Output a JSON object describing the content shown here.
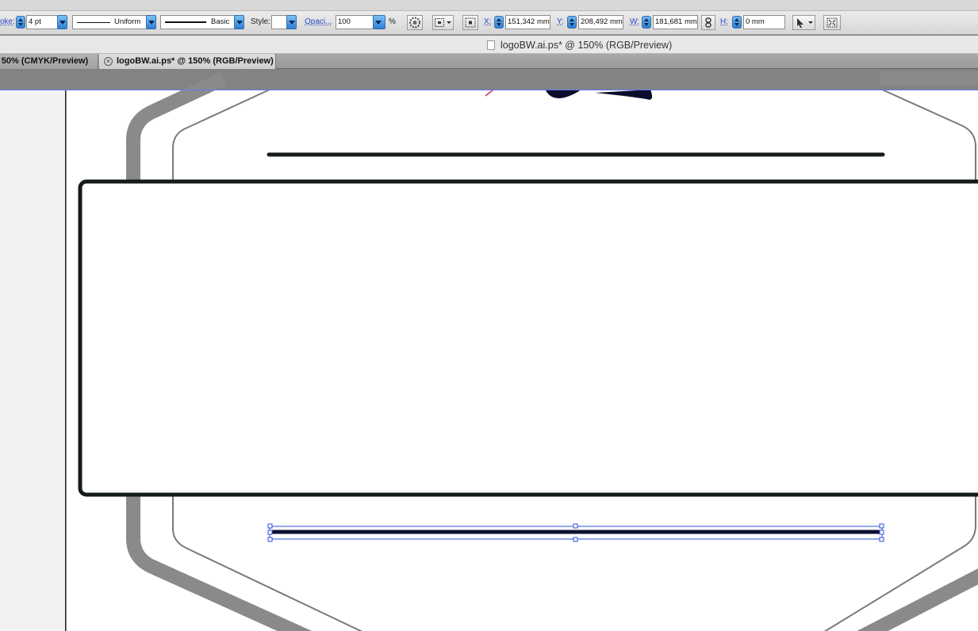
{
  "control_bar": {
    "stroke_label": "oke:",
    "stroke_weight": "4 pt",
    "profile_label": "Uniform",
    "brush_label": "Basic",
    "style_label": "Style:",
    "opacity_label": "Opaci...",
    "opacity_value": "100",
    "percent": "%",
    "x_label": "X:",
    "x_value": "151,342 mm",
    "y_label": "Y:",
    "y_value": "208,492 mm",
    "w_label": "W:",
    "w_value": "181,681 mm",
    "h_label": "H:",
    "h_value": "0 mm"
  },
  "document": {
    "title": "logoBW.ai.ps* @ 150% (RGB/Preview)"
  },
  "tabs": [
    {
      "label": "o 50% (CMYK/Preview)",
      "active": false
    },
    {
      "label": "logoBW.ai.ps* @ 150% (RGB/Preview)",
      "active": true
    }
  ],
  "colors": {
    "selection": "#2f4fd8",
    "stroke_dark": "#151a1a",
    "hexagon_outer": "#8a8a8a",
    "hexagon_inner": "#7a7a7a",
    "accent_red": "#d0374f"
  }
}
